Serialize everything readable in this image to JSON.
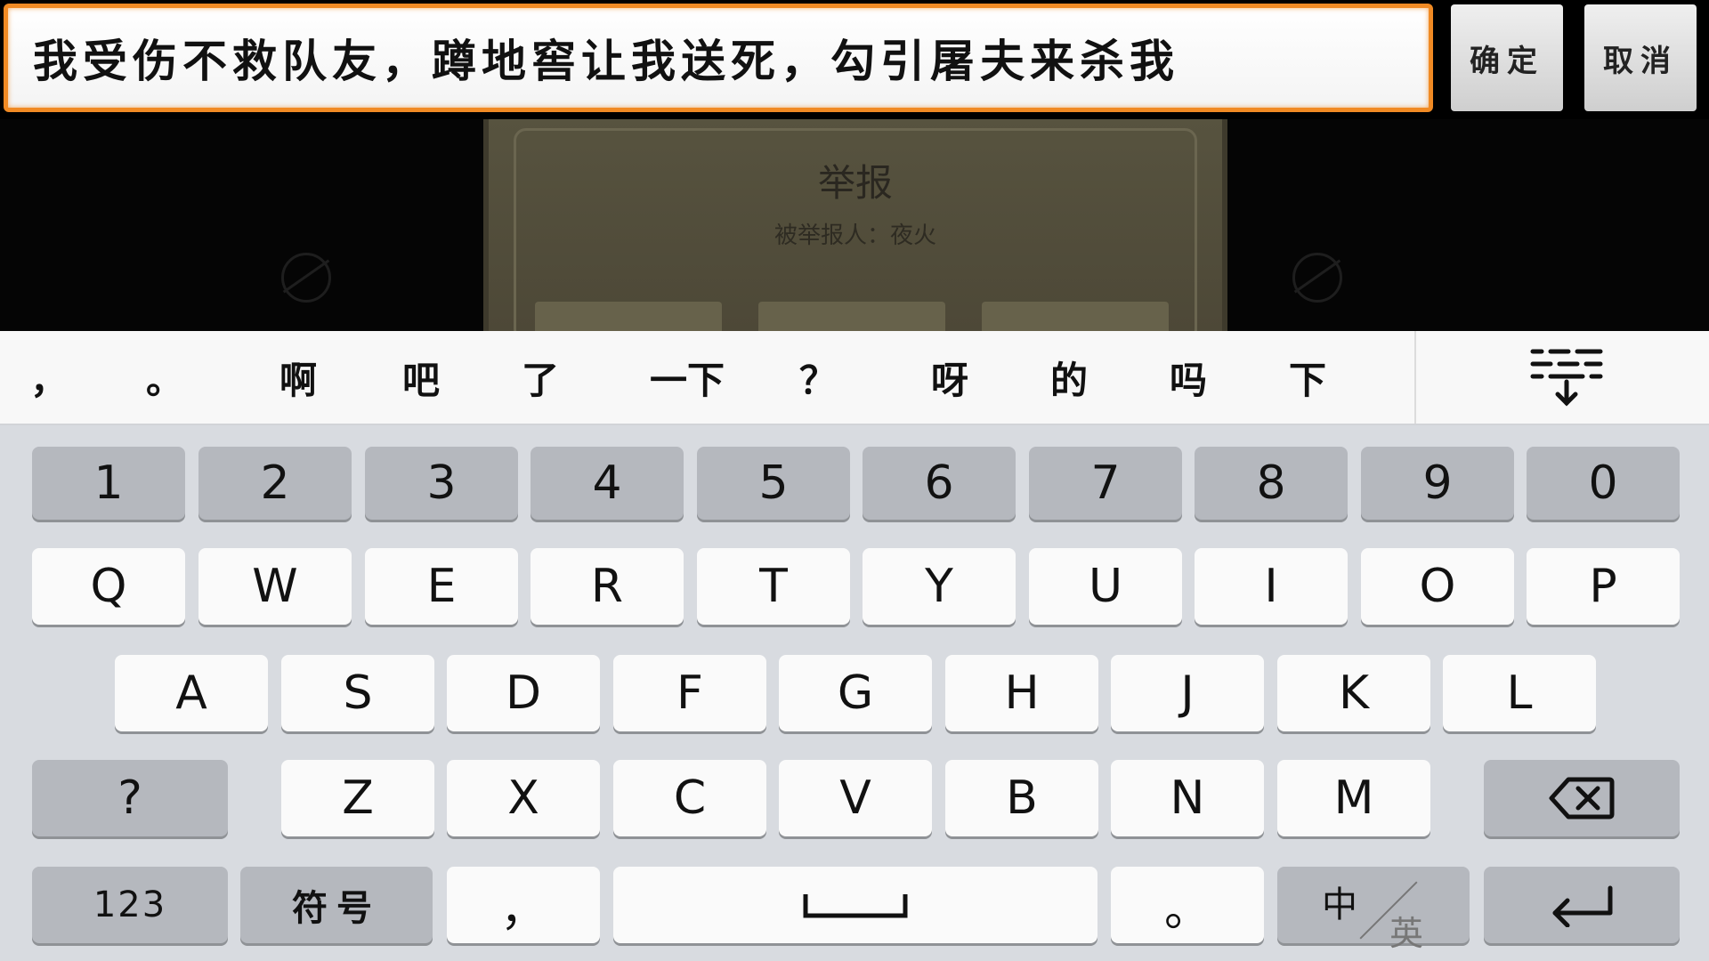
{
  "input": {
    "value": "我受伤不救队友，蹲地窖让我送死，勾引屠夫来杀我"
  },
  "buttons": {
    "confirm": "确定",
    "cancel": "取消"
  },
  "dialog": {
    "title": "举报",
    "subtitle": "被举报人：夜火"
  },
  "candidates": [
    "，",
    "。",
    "啊",
    "吧",
    "了",
    "一下",
    "？",
    "呀",
    "的",
    "吗",
    "下"
  ],
  "keyboard": {
    "numbers": [
      "1",
      "2",
      "3",
      "4",
      "5",
      "6",
      "7",
      "8",
      "9",
      "0"
    ],
    "row1": [
      "Q",
      "W",
      "E",
      "R",
      "T",
      "Y",
      "U",
      "I",
      "O",
      "P"
    ],
    "row2": [
      "A",
      "S",
      "D",
      "F",
      "G",
      "H",
      "J",
      "K",
      "L"
    ],
    "row3": [
      "Z",
      "X",
      "C",
      "V",
      "B",
      "N",
      "M"
    ],
    "question": "?",
    "num_mode": "123",
    "symbols": "符号",
    "comma": "，",
    "period": "。",
    "lang_cn": "中",
    "lang_en": "英"
  },
  "colors": {
    "input_border": "#f08a24",
    "keyboard_bg": "#d8dbe0",
    "key_bg": "#fafafa",
    "func_key_bg": "#b5b8be"
  },
  "icons": {
    "collapse": "keyboard-collapse-icon",
    "backspace": "backspace-icon",
    "space": "space-icon",
    "enter": "enter-icon"
  }
}
